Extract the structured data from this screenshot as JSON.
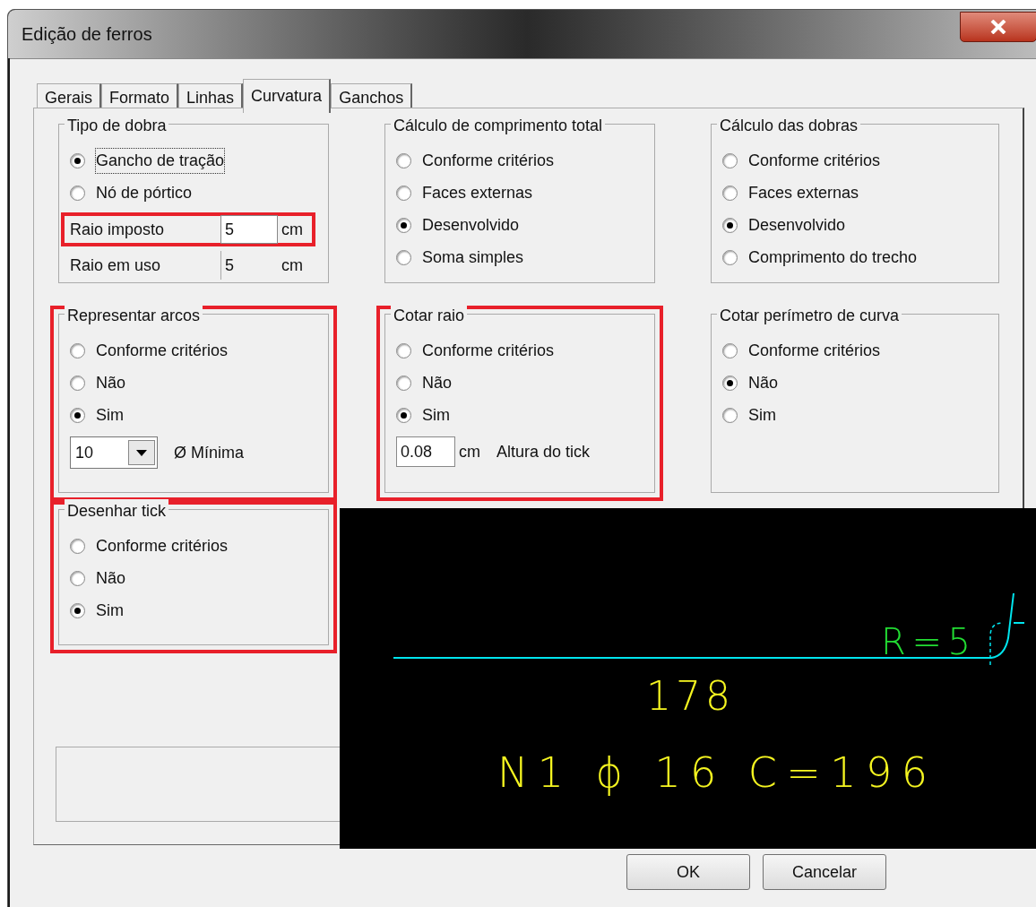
{
  "window": {
    "title": "Edição de ferros"
  },
  "tabs": [
    {
      "label": "Gerais",
      "selected": false
    },
    {
      "label": "Formato",
      "selected": false
    },
    {
      "label": "Linhas",
      "selected": false
    },
    {
      "label": "Curvatura",
      "selected": true
    },
    {
      "label": "Ganchos",
      "selected": false
    }
  ],
  "groups": [
    {
      "title": "Tipo de dobra",
      "highlighted": false,
      "options": [
        {
          "label": "Gancho de tração",
          "selected": true,
          "focused": true
        },
        {
          "label": "Nó de pórtico",
          "selected": false,
          "focused": false
        }
      ],
      "rows": [
        {
          "kind": "field",
          "label": "Raio imposto",
          "value": "5",
          "unit": "cm",
          "disabled": false,
          "highlighted": true
        },
        {
          "kind": "field",
          "label": "Raio em uso",
          "value": "5",
          "unit": "cm",
          "disabled": true,
          "highlighted": false
        }
      ]
    },
    {
      "title": "Cálculo de comprimento total",
      "highlighted": false,
      "options": [
        {
          "label": "Conforme critérios",
          "selected": false
        },
        {
          "label": "Faces externas",
          "selected": false
        },
        {
          "label": "Desenvolvido",
          "selected": true
        },
        {
          "label": "Soma simples",
          "selected": false
        }
      ]
    },
    {
      "title": "Cálculo das dobras",
      "highlighted": false,
      "options": [
        {
          "label": "Conforme critérios",
          "selected": false
        },
        {
          "label": "Faces externas",
          "selected": false
        },
        {
          "label": "Desenvolvido",
          "selected": true
        },
        {
          "label": "Comprimento do trecho",
          "selected": false
        }
      ]
    },
    {
      "title": "Representar arcos",
      "highlighted": true,
      "options": [
        {
          "label": "Conforme critérios",
          "selected": false
        },
        {
          "label": "Não",
          "selected": false
        },
        {
          "label": "Sim",
          "selected": true
        }
      ],
      "rows": [
        {
          "kind": "dropdown",
          "value": "10",
          "label": "Ø Mínima"
        }
      ]
    },
    {
      "title": "Cotar raio",
      "highlighted": true,
      "options": [
        {
          "label": "Conforme critérios",
          "selected": false
        },
        {
          "label": "Não",
          "selected": false
        },
        {
          "label": "Sim",
          "selected": true
        }
      ],
      "rows": [
        {
          "kind": "input",
          "value": "0.08",
          "unit": "cm",
          "label": "Altura do tick"
        }
      ]
    },
    {
      "title": "Cotar perímetro de curva",
      "highlighted": false,
      "options": [
        {
          "label": "Conforme critérios",
          "selected": false
        },
        {
          "label": "Não",
          "selected": true
        },
        {
          "label": "Sim",
          "selected": false
        }
      ]
    },
    {
      "title": "Desenhar tick",
      "highlighted": true,
      "options": [
        {
          "label": "Conforme critérios",
          "selected": false
        },
        {
          "label": "Não",
          "selected": false
        },
        {
          "label": "Sim",
          "selected": true
        }
      ]
    }
  ],
  "preview": {
    "radius_label": "R=5",
    "length_label": "178",
    "bar_label": "N1  ϕ  16  C=196"
  },
  "buttons": [
    "OK",
    "Cancelar"
  ]
}
